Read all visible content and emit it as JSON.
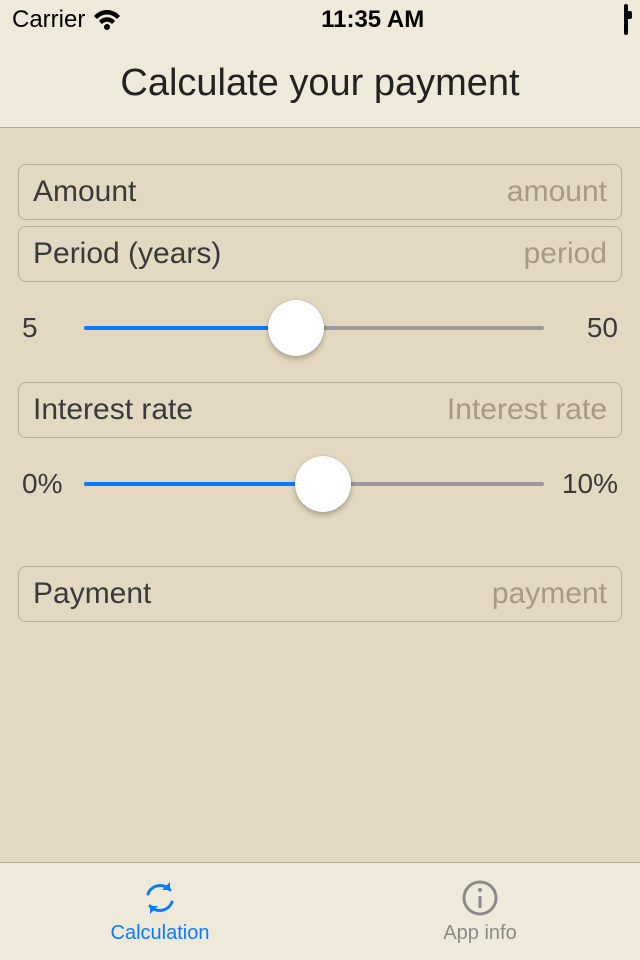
{
  "status": {
    "carrier": "Carrier",
    "time": "11:35 AM"
  },
  "title": "Calculate your payment",
  "fields": {
    "amount": {
      "label": "Amount",
      "placeholder": "amount"
    },
    "period": {
      "label": "Period (years)",
      "placeholder": "period"
    },
    "interest": {
      "label": "Interest rate",
      "placeholder": "Interest rate"
    },
    "payment": {
      "label": "Payment",
      "placeholder": "payment"
    }
  },
  "sliders": {
    "period": {
      "min_label": "5",
      "max_label": "50",
      "percent": 46
    },
    "interest": {
      "min_label": "0%",
      "max_label": "10%",
      "percent": 52
    }
  },
  "tabs": {
    "calculation": "Calculation",
    "appinfo": "App info"
  },
  "colors": {
    "accent": "#0a7bff"
  }
}
